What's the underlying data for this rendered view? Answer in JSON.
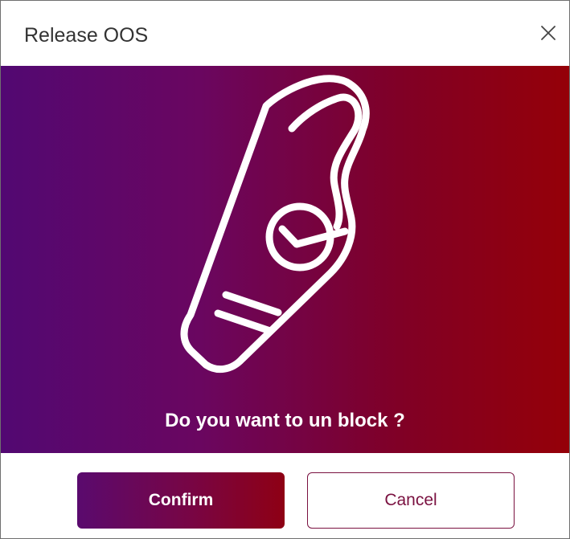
{
  "dialog": {
    "title": "Release OOS",
    "close_icon": "close-icon",
    "hero": {
      "illustration_icon": "door-hanger-check-icon",
      "question": "Do you want to un block ?",
      "gradient_colors": [
        "#520872",
        "#950008"
      ]
    },
    "actions": {
      "confirm_label": "Confirm",
      "cancel_label": "Cancel"
    }
  }
}
